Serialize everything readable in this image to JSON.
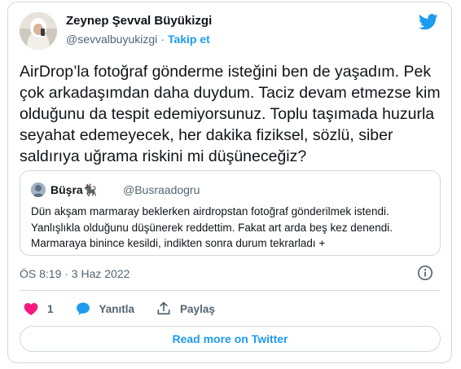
{
  "author": {
    "name": "Zeynep Şevval Büyükizgi",
    "handle": "@sevvalbuyukizgi",
    "separator": "·",
    "follow_label": "Takip et"
  },
  "tweet": {
    "text": "AirDrop’la fotoğraf gönderme isteğini ben de yaşadım. Pek çok arkadaşımdan daha duydum. Taciz devam etmezse kim olduğunu da tespit edemiyorsunuz. Toplu taşımada huzurla seyahat edemeyecek, her dakika fiziksel, sözlü, siber saldırıya uğrama riskini mi düşüneceğiz?"
  },
  "quote": {
    "name": "Büşra",
    "emoji": "🐈‍⬛",
    "handle": "@Busraadogru",
    "lines": [
      "Dün akşam marmaray beklerken airdropstan fotoğraf gönderilmek istendi.",
      "Yanlışlıkla olduğunu düşünerek reddettim. Fakat art arda beş kez denendi.",
      "Marmaraya binince kesildi, indikten sonra durum tekrarladı +"
    ]
  },
  "meta": {
    "timestamp": "ÖS 8:19 · 3 Haz 2022"
  },
  "actions": {
    "like_count": "1",
    "reply_label": "Yanıtla",
    "share_label": "Paylaş"
  },
  "read_more_label": "Read more on Twitter",
  "colors": {
    "accent": "#1d9bf0",
    "like": "#f91880",
    "text": "#0f1419",
    "muted": "#536471",
    "border": "#cfd9de"
  },
  "icons": [
    "twitter-bird-icon",
    "heart-icon",
    "reply-bubble-icon",
    "share-icon",
    "info-icon"
  ]
}
